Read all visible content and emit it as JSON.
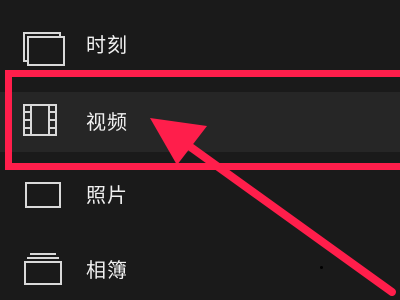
{
  "menu": {
    "items": [
      {
        "label": "时刻",
        "icon": "stacked-frames-icon"
      },
      {
        "label": "视频",
        "icon": "film-strip-icon"
      },
      {
        "label": "照片",
        "icon": "photo-frame-icon"
      },
      {
        "label": "相簿",
        "icon": "album-stack-icon"
      }
    ],
    "selected_index": 1
  },
  "annotation": {
    "color": "#ff1e4b",
    "type": "highlight-box-with-arrow"
  },
  "colors": {
    "background": "#1a1a1a",
    "text": "#f0f0f0",
    "icon_stroke": "#d9d9d9"
  }
}
